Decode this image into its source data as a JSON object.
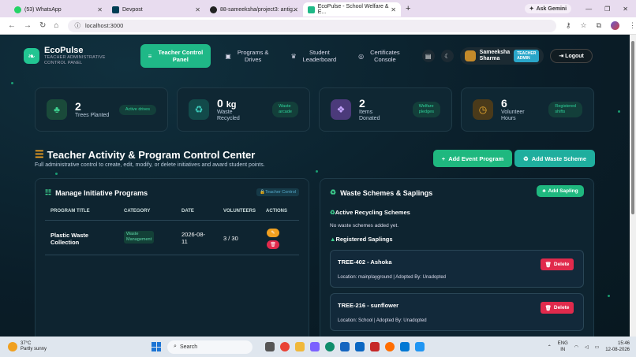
{
  "browser": {
    "tabs": [
      {
        "title": "(53) WhatsApp",
        "color": "#25d366"
      },
      {
        "title": "Devpost",
        "color": "#003e54"
      },
      {
        "title": "88-sameeksha/project3: antig...",
        "color": "#222"
      },
      {
        "title": "EcoPulse - School Welfare & E...",
        "color": "#1fb887"
      }
    ],
    "gemini": "Ask Gemini",
    "url": "localhost:3000"
  },
  "app": {
    "name": "EcoPulse",
    "subtitle1": "TEACHER ADMINISTRATIVE",
    "subtitle2": "CONTROL PANEL",
    "nav": [
      {
        "l1": "Teacher Control",
        "l2": "Panel",
        "icon": "≡"
      },
      {
        "l1": "Programs &",
        "l2": "Drives",
        "icon": "▣"
      },
      {
        "l1": "Student",
        "l2": "Leaderboard",
        "icon": "♛"
      },
      {
        "l1": "Certificates",
        "l2": "Console",
        "icon": "◎"
      }
    ],
    "user": {
      "first": "Sameeksha",
      "last": "Sharma",
      "role1": "TEACHER",
      "role2": "ADMIN"
    },
    "logout": "Logout"
  },
  "stats": [
    {
      "num": "2",
      "unit": "",
      "l1": "Trees Planted",
      "l2": "",
      "pill1": "Active drives",
      "pill2": "",
      "iconColor": "#1a4a3a",
      "icon": "♣"
    },
    {
      "num": "0",
      "unit": "kg",
      "l1": "Waste",
      "l2": "Recycled",
      "pill1": "Waste",
      "pill2": "arcade",
      "iconColor": "#124a4a",
      "icon": "♻"
    },
    {
      "num": "2",
      "unit": "",
      "l1": "Items",
      "l2": "Donated",
      "pill1": "Welfare",
      "pill2": "pledges",
      "iconColor": "#4b3a7a",
      "icon": "❖"
    },
    {
      "num": "6",
      "unit": "",
      "l1": "Volunteer",
      "l2": "Hours",
      "pill1": "Registered",
      "pill2": "shifts",
      "iconColor": "#4a3a1a",
      "icon": "◷"
    }
  ],
  "center": {
    "title": "Teacher Activity & Program Control Center",
    "desc": "Full administrative control to create, edit, modify, or delete initiatives and award student points.",
    "btn_event": "Add Event Program",
    "btn_waste": "Add Waste Scheme"
  },
  "programs": {
    "title": "Manage Initiative Programs",
    "badge": "Teacher Control",
    "headers": [
      "PROGRAM TITLE",
      "CATEGORY",
      "DATE",
      "VOLUNTEERS",
      "ACTIONS"
    ],
    "rows": [
      {
        "t1": "Plastic Waste",
        "t2": "Collection",
        "c1": "Waste",
        "c2": "Management",
        "d1": "2026-08-",
        "d2": "11",
        "vol": "3 / 30"
      }
    ]
  },
  "waste": {
    "title": "Waste Schemes & Saplings",
    "add": "Add Sapling",
    "recycling": "Active Recycling Schemes",
    "none": "No waste schemes added yet.",
    "registered": "Registered Saplings",
    "saplings": [
      {
        "title": "TREE-402 - Ashoka",
        "loc": "Location: mainplayground | Adopted By: Unadopted"
      },
      {
        "title": "TREE-216 - sunflower",
        "loc": "Location: School | Adopted By: Unadopted"
      }
    ],
    "delete": "Delete"
  },
  "taskbar": {
    "temp": "37°C",
    "cond": "Partly sunny",
    "search": "Search",
    "lang1": "ENG",
    "lang2": "IN",
    "time": "15:46",
    "date": "12-08-2026"
  }
}
